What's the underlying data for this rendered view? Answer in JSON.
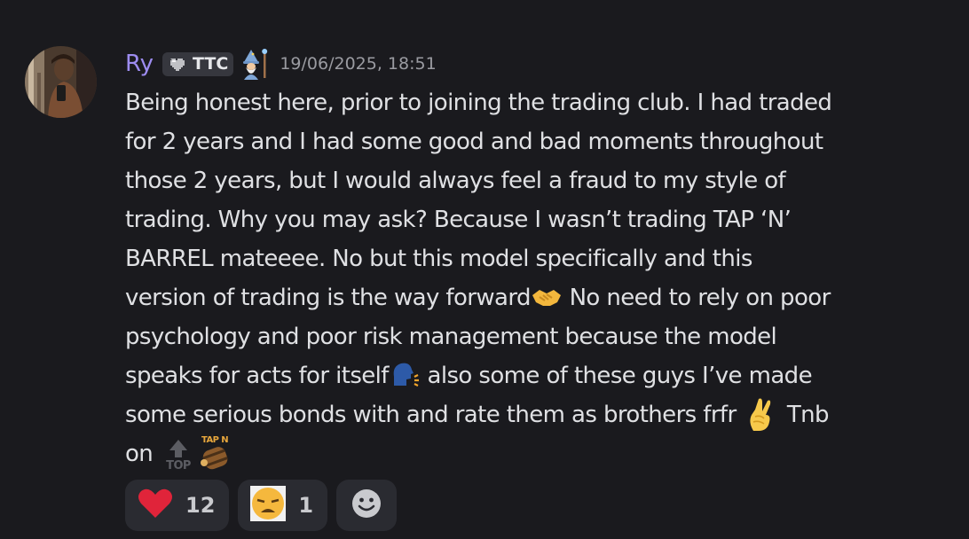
{
  "message": {
    "author": "Ry",
    "role_tag": "TTC",
    "timestamp": "19/06/2025, 18:51",
    "lines": [
      "Being honest here, prior to joining the trading club. I had traded",
      "for 2 years and I had some good and bad moments throughout",
      "those 2 years, but I would always feel a fraud to my style of",
      "trading. Why you may ask? Because I wasn’t trading TAP ‘N’",
      "BARREL mateeee. No but this model specifically and this"
    ],
    "line6_before": "version of trading is the way forward",
    "line6_after": " No need to rely on poor",
    "line7": "psychology and poor risk management because the model",
    "line8_before": "speaks for acts for itself",
    "line8_after": " also some of these guys I’ve made",
    "line9_before": "some serious bonds with and rate them as brothers frfr ",
    "line9_after": " Tnb",
    "line10": "on ",
    "top_emoji_text": "TOP",
    "tapn_emoji_text": "TAP N"
  },
  "reactions": [
    {
      "icon": "heart-icon",
      "count": "12",
      "color": "#e0243a"
    },
    {
      "icon": "weary-face-icon",
      "count": "1",
      "color": "#f5b83d"
    }
  ],
  "colors": {
    "background": "#1a1a1e",
    "username": "#9d8cf0",
    "text": "#dfe0e3",
    "timestamp": "#9a9ba1",
    "reaction_bg": "#2a2b31"
  }
}
